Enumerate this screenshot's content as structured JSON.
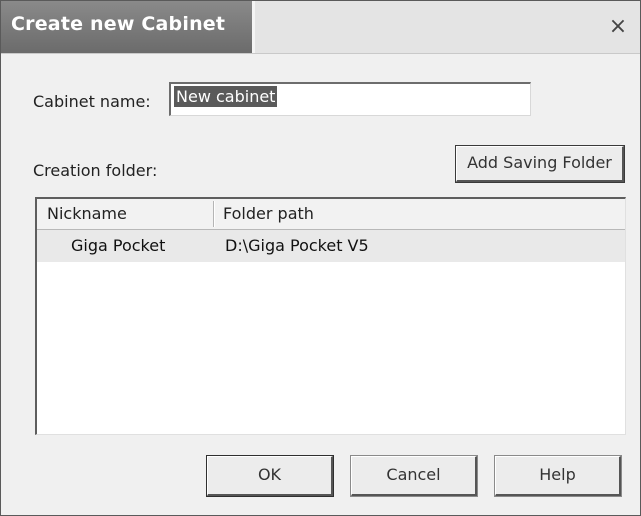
{
  "dialog": {
    "title": "Create new Cabinet",
    "close_glyph": "×"
  },
  "form": {
    "cabinet_name_label": "Cabinet name:",
    "cabinet_name_value": "New cabinet",
    "creation_folder_label": "Creation folder:",
    "add_saving_folder_label": "Add Saving Folder"
  },
  "table": {
    "columns": [
      "Nickname",
      "Folder path"
    ],
    "rows": [
      {
        "nickname": "Giga Pocket",
        "folder_path": "D:\\Giga Pocket V5",
        "selected": true
      }
    ]
  },
  "buttons": {
    "ok_label": "OK",
    "cancel_label": "Cancel",
    "help_label": "Help"
  },
  "icons": {
    "close": "close-icon"
  },
  "colors": {
    "title_tab_bg": "#7a7a7a",
    "selection_bg": "#5a5a5a",
    "dialog_bg": "#f0f0f0"
  }
}
